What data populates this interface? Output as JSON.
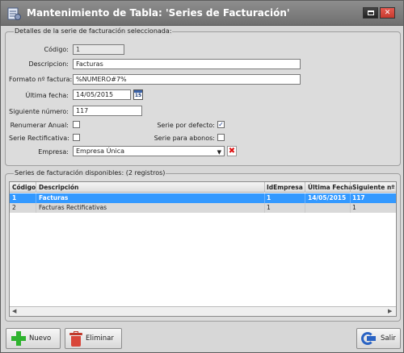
{
  "window": {
    "title": "Mantenimiento de Tabla: 'Series de Facturación'",
    "icons": {
      "app": "table-app-icon",
      "restore": "restore-icon",
      "close": "close-icon"
    }
  },
  "details": {
    "legend": "Detalles de la serie de facturación seleccionada:",
    "codigo": {
      "label": "Código:",
      "value": "1"
    },
    "descripcion": {
      "label": "Descripcion:",
      "value": "Facturas"
    },
    "formato": {
      "label": "Formato nº factura:",
      "value": "%NUMERO#7%"
    },
    "ultima_fecha": {
      "label": "Última fecha:",
      "value": "14/05/2015",
      "calendar_text": "15"
    },
    "siguiente": {
      "label": "Siguiente número:",
      "value": "117"
    },
    "renumerar": {
      "label": "Renumerar Anual:",
      "checked": false
    },
    "rectificativa": {
      "label": "Serie Rectificativa:",
      "checked": false
    },
    "por_defecto": {
      "label": "Serie por defecto:",
      "checked": true,
      "mark": "✓"
    },
    "para_abonos": {
      "label": "Serie para abonos:",
      "checked": false
    },
    "empresa": {
      "label": "Empresa:",
      "value": "Empresa Única"
    }
  },
  "list": {
    "legend": "Series de facturación disponibles: (2 registros)",
    "columns": [
      "Código",
      "Descripción",
      "IdEmpresa",
      "Última Fecha",
      "Siguiente nº"
    ],
    "rows": [
      {
        "codigo": "1",
        "descripcion": "Facturas",
        "idempresa": "1",
        "ultima_fecha": "14/05/2015",
        "siguiente": "117",
        "selected": true
      },
      {
        "codigo": "2",
        "descripcion": "Facturas Rectificativas",
        "idempresa": "1",
        "ultima_fecha": "",
        "siguiente": "1",
        "selected": false
      }
    ]
  },
  "buttons": {
    "nuevo": "Nuevo",
    "eliminar": "Eliminar",
    "salir": "Salir"
  },
  "colors": {
    "selection": "#3399ff",
    "add_icon": "#2fb32f",
    "delete_icon": "#d8463a",
    "exit_icon": "#2a63c4",
    "close_button": "#d84a3e"
  }
}
